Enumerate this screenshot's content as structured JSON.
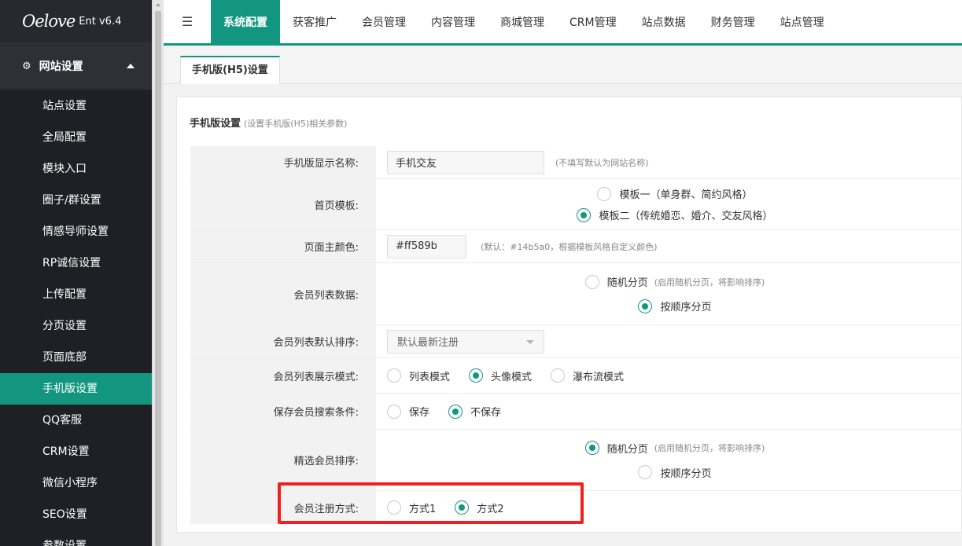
{
  "app": {
    "logo_script": "Oelove",
    "version": "Ent v6.4"
  },
  "sidebar": {
    "group": {
      "label": "网站设置",
      "icon": "gear-icon"
    },
    "items": [
      {
        "label": "站点设置"
      },
      {
        "label": "全局配置"
      },
      {
        "label": "模块入口"
      },
      {
        "label": "圈子/群设置"
      },
      {
        "label": "情感导师设置"
      },
      {
        "label": "RP诚信设置"
      },
      {
        "label": "上传配置"
      },
      {
        "label": "分页设置"
      },
      {
        "label": "页面底部"
      },
      {
        "label": "手机版设置",
        "active": true
      },
      {
        "label": "QQ客服"
      },
      {
        "label": "CRM设置"
      },
      {
        "label": "微信小程序"
      },
      {
        "label": "SEO设置"
      },
      {
        "label": "参数设置"
      }
    ]
  },
  "topnav": {
    "toggle_icon": "menu-toggle-icon",
    "tabs": [
      {
        "label": "系统配置",
        "active": true
      },
      {
        "label": "获客推广"
      },
      {
        "label": "会员管理"
      },
      {
        "label": "内容管理"
      },
      {
        "label": "商城管理"
      },
      {
        "label": "CRM管理"
      },
      {
        "label": "站点数据"
      },
      {
        "label": "财务管理"
      },
      {
        "label": "站点管理"
      }
    ]
  },
  "subtab": {
    "label": "手机版(H5)设置"
  },
  "panel": {
    "title": "手机版设置",
    "subtitle": "(设置手机版(H5)相关参数)"
  },
  "form": {
    "display_name": {
      "label": "手机版显示名称:",
      "value": "手机交友",
      "hint": "(不填写默认为网站名称)"
    },
    "home_template": {
      "label": "首页模板:",
      "options": [
        "模板一（单身群、简约风格）",
        "模板二（传统婚恋、婚介、交友风格）"
      ],
      "selected": 1
    },
    "main_color": {
      "label": "页面主颜色:",
      "value": "#ff589b",
      "hint": "(默认：#14b5a0，根据模板风格自定义颜色)"
    },
    "member_list_data": {
      "label": "会员列表数据:",
      "options": [
        "随机分页",
        "按顺序分页"
      ],
      "selected": 1,
      "hint": "(启用随机分页，将影响排序)"
    },
    "member_list_sort": {
      "label": "会员列表默认排序:",
      "value": "默认最新注册"
    },
    "member_list_mode": {
      "label": "会员列表展示模式:",
      "options": [
        "列表模式",
        "头像模式",
        "瀑布流模式"
      ],
      "selected": 1
    },
    "save_search": {
      "label": "保存会员搜索条件:",
      "options": [
        "保存",
        "不保存"
      ],
      "selected": 1
    },
    "featured_sort": {
      "label": "精选会员排序:",
      "options": [
        "随机分页",
        "按顺序分页"
      ],
      "selected": 0,
      "hint": "(启用随机分页，将影响排序)"
    },
    "register_method": {
      "label": "会员注册方式:",
      "options": [
        "方式1",
        "方式2"
      ],
      "selected": 1
    }
  },
  "colors": {
    "accent": "#12967f",
    "sidebar_bg": "#28292e",
    "highlight": "#f0211c"
  }
}
